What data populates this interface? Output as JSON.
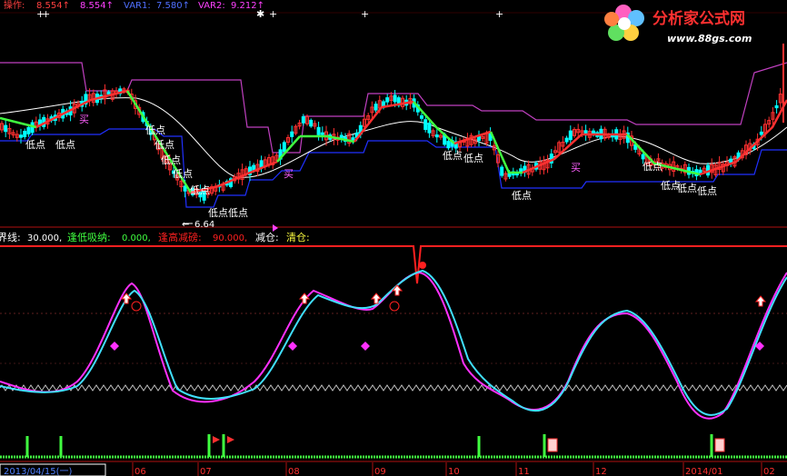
{
  "top_indicator": {
    "name": "操作:",
    "v1": "8.554↑",
    "v2": "8.554↑",
    "var1_label": "VAR1:",
    "var1_value": "7.580↑",
    "var2_label": "VAR2:",
    "var2_value": "9.212↑"
  },
  "watermark": {
    "title": "分析家公式网",
    "url": "www.88gs.com"
  },
  "price_panel": {
    "low_label": "低点",
    "buy_label": "买",
    "min_price_label": "6.64"
  },
  "bottom_indicator": {
    "line_label": "界线:",
    "line_value": "30.000,",
    "buy_low_label": "逢低吸纳:",
    "buy_low_value": "0.000,",
    "sell_high_label": "逢高减磅:",
    "sell_high_value": "90.000,",
    "reduce_label": "减仓:",
    "clear_label": "清仓:"
  },
  "time_axis": {
    "cursor_date": "2013/04/15(一)",
    "months": [
      "06",
      "07",
      "08",
      "09",
      "10",
      "11",
      "12",
      "2014/01",
      "02"
    ]
  },
  "colors": {
    "background": "#000000",
    "up": "#ff3030",
    "down": "#00ffff",
    "ma_green": "#40ff40",
    "ma_white": "#ffffff",
    "band_upper": "#c040c0",
    "band_lower": "#2030ff",
    "osc_magenta": "#ff30ff",
    "osc_cyan": "#40e0ff",
    "signal_red": "#ff2020",
    "axis_red": "#b01010"
  }
}
